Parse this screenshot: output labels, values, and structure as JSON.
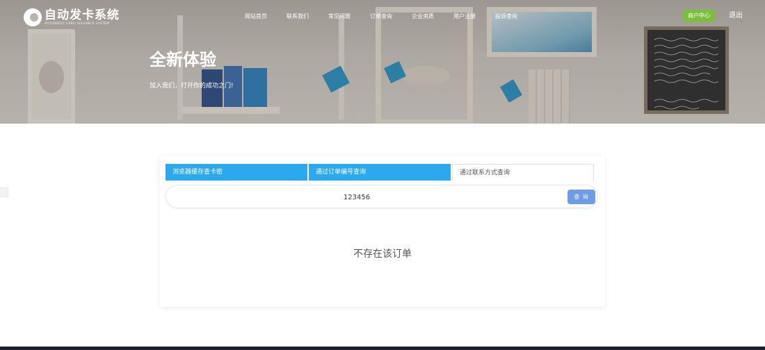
{
  "header": {
    "logo_title": "自动发卡系统",
    "logo_subtitle": "AUTOMATIC CARD ISSUANCE SYSTEM",
    "nav": [
      "网站首页",
      "联系我们",
      "常见问题",
      "订单查询",
      "企业资质",
      "用户注册",
      "投诉查询"
    ],
    "merchant_button": "商户中心",
    "logout": "退出"
  },
  "hero": {
    "title": "全新体验",
    "subtitle": "加入我们，打开你的成功之门!"
  },
  "query": {
    "tabs": [
      {
        "label": "浏览器缓存查卡密",
        "active": false
      },
      {
        "label": "通过订单编号查询",
        "active": false
      },
      {
        "label": "通过联系方式查询",
        "active": true
      }
    ],
    "input_value": "123456",
    "search_button": "查 询",
    "result_text": "不存在该订单"
  },
  "colors": {
    "tab_blue": "#2ca8ef",
    "search_button": "#6f9ce6",
    "merchant_button": "#7cbf3f",
    "footer": "#1e2230"
  }
}
